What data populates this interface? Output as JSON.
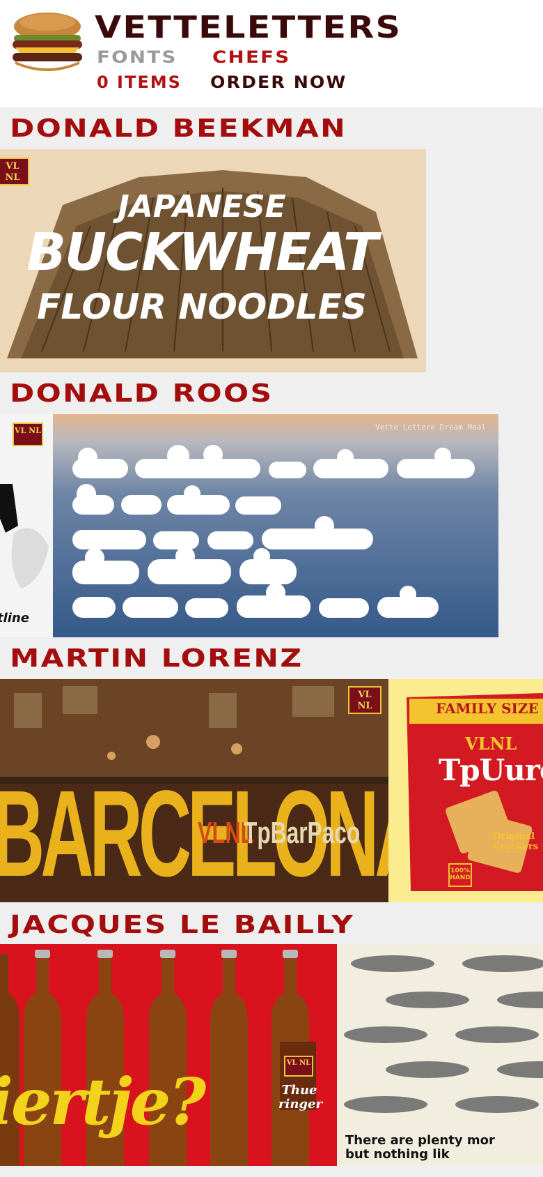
{
  "header": {
    "brand": "VETTELETTERS",
    "nav_fonts": "FONTS",
    "nav_chefs": "CHEFS",
    "cart_items": "0 ITEMS",
    "order_now": "ORDER NOW"
  },
  "sections": [
    {
      "chef": "DONALD BEEKMAN",
      "cards": [
        {
          "lines": [
            "JAPANESE",
            "BUCKWHEAT",
            "FLOUR NOODLES"
          ],
          "badge": "VL NL"
        }
      ]
    },
    {
      "chef": "DONALD ROOS",
      "cards": [
        {
          "partial_text": "tline",
          "badge": "VL NL"
        },
        {
          "caption": "Vette Lettere Dream Meal"
        }
      ]
    },
    {
      "chef": "MARTIN LORENZ",
      "cards": [
        {
          "big_word": "BARCELONA",
          "overlay_brand": "VLNL",
          "overlay_font": "TpBarPaco",
          "badge": "VL NL"
        },
        {
          "box_top": "FAMILY SIZE",
          "box_brand": "VLNL",
          "box_font": "TpUuro",
          "box_side": "Original Crackers",
          "box_seal": "100% HAND"
        }
      ]
    },
    {
      "chef": "JACQUES LE BAILLY",
      "cards": [
        {
          "word": "iertje?",
          "label_badge": "VL NL",
          "label_text": "Thue ringer"
        },
        {
          "line1": "There are plenty mor",
          "line2": "but nothing lik"
        }
      ]
    }
  ]
}
